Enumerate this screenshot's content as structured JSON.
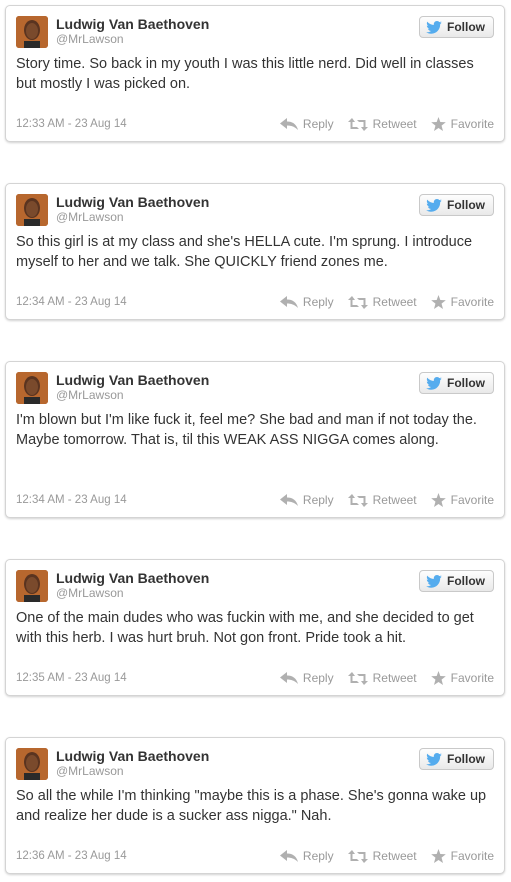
{
  "colors": {
    "accent": "#55acee",
    "text": "#333333",
    "muted": "#999999",
    "border": "#d4d4d4"
  },
  "icons": {
    "follow": "twitter-bird-icon",
    "reply": "reply-arrow-icon",
    "retweet": "retweet-icon",
    "favorite": "star-icon"
  },
  "labels": {
    "follow": "Follow",
    "reply": "Reply",
    "retweet": "Retweet",
    "favorite": "Favorite"
  },
  "tweets": [
    {
      "name": "Ludwig Van Baethoven",
      "handle": "@MrLawson",
      "text": "Story time. So back in my youth I was this little nerd. Did well in classes but mostly I was picked on.",
      "time": "12:33 AM - 23 Aug 14"
    },
    {
      "name": "Ludwig Van Baethoven",
      "handle": "@MrLawson",
      "text": "So this girl is at my class and she's HELLA cute. I'm sprung. I introduce myself to her and we talk. She QUICKLY friend zones me.",
      "time": "12:34 AM - 23 Aug 14"
    },
    {
      "name": "Ludwig Van Baethoven",
      "handle": "@MrLawson",
      "text": "I'm blown but I'm like fuck it, feel me? She bad and man if not today the. Maybe tomorrow. That is, til this WEAK ASS NIGGA comes along.",
      "time": "12:34 AM - 23 Aug 14"
    },
    {
      "name": "Ludwig Van Baethoven",
      "handle": "@MrLawson",
      "text": "One of the main dudes who was fuckin with me, and she decided to get with this herb. I was hurt bruh. Not gon front. Pride took a hit.",
      "time": "12:35 AM - 23 Aug 14"
    },
    {
      "name": "Ludwig Van Baethoven",
      "handle": "@MrLawson",
      "text": "So all the while I'm thinking \"maybe this is a phase. She's gonna wake up and realize her dude is a sucker ass nigga.\" Nah.",
      "time": "12:36 AM - 23 Aug 14"
    }
  ]
}
